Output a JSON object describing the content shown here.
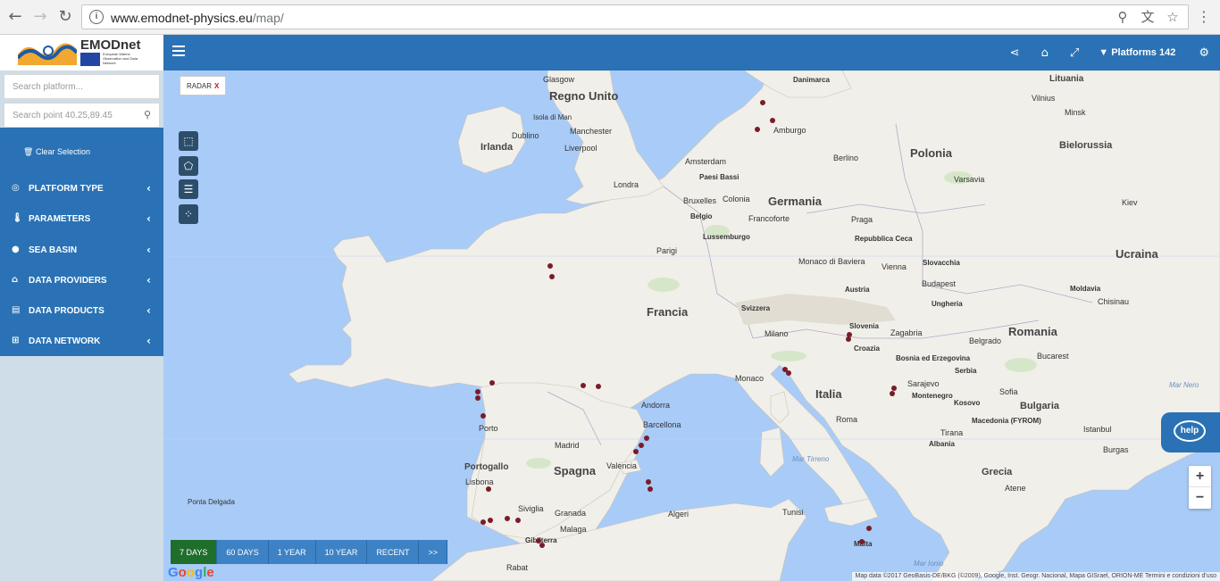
{
  "browser": {
    "url_host": "www.emodnet-physics.eu",
    "url_path": "/map/"
  },
  "header": {
    "logo_text": "EMODnet",
    "logo_sub": "European Marine Observation and Data Network",
    "platforms_label": "Platforms 142"
  },
  "sidebar": {
    "search_platform_placeholder": "Search platform...",
    "search_point_placeholder": "Search point 40.25,89.45",
    "clear_selection": "Clear Selection",
    "items": [
      {
        "label": "PLATFORM TYPE",
        "icon": "target-icon"
      },
      {
        "label": "PARAMETERS",
        "icon": "thermometer-icon"
      },
      {
        "label": "SEA BASIN",
        "icon": "globe-icon"
      },
      {
        "label": "DATA PROVIDERS",
        "icon": "institution-icon"
      },
      {
        "label": "DATA PRODUCTS",
        "icon": "server-icon"
      },
      {
        "label": "DATA NETWORK",
        "icon": "sitemap-icon"
      }
    ]
  },
  "map": {
    "filter_chip": "RADAR",
    "filter_chip_close": "X",
    "time_buttons": [
      "7 DAYS",
      "60 DAYS",
      "1 YEAR",
      "10 YEAR",
      "RECENT",
      ">>"
    ],
    "active_time_button": "7 DAYS",
    "attribution": "Map data ©2017 GeoBasis-DE/BKG (©2009), Google, Inst. Geogr. Nacional, Mapa GISrael, ORION-ME   Termini e condizioni d'uso",
    "google": "Google",
    "help": "help",
    "zoom_in": "+",
    "zoom_out": "−",
    "countries": [
      "Regno Unito",
      "Irlanda",
      "Francia",
      "Spagna",
      "Portogallo",
      "Germania",
      "Polonia",
      "Italia",
      "Ucraina",
      "Romania",
      "Bielorussia",
      "Lituania",
      "Danimarca",
      "Belgio",
      "Paesi Bassi",
      "Svizzera",
      "Austria",
      "Slovacchia",
      "Ungheria",
      "Croazia",
      "Slovenia",
      "Serbia",
      "Bulgaria",
      "Grecia",
      "Albania",
      "Moldavia",
      "Repubblica Ceca",
      "Malta",
      "Gibilterra",
      "Lussemburgo",
      "Montenegro",
      "Macedonia (FYROM)",
      "Kosovo",
      "Bosnia ed Erzegovina"
    ],
    "cities": [
      "Glasgow",
      "Isola di Man",
      "Dublino",
      "Manchester",
      "Liverpool",
      "Londra",
      "Amsterdam",
      "Bruxelles",
      "Amburgo",
      "Berlino",
      "Varsavia",
      "Praga",
      "Monaco di Baviera",
      "Vienna",
      "Budapest",
      "Parigi",
      "Milano",
      "Monaco",
      "Roma",
      "Madrid",
      "Lisbona",
      "Porto",
      "Siviglia",
      "Granada",
      "Malaga",
      "Valencia",
      "Barcellona",
      "Andorra",
      "Algeri",
      "Tunisi",
      "Rabat",
      "Belgrado",
      "Sofia",
      "Bucarest",
      "Kiev",
      "Minsk",
      "Vilnius",
      "Zagabria",
      "Sarajevo",
      "Tirana",
      "Atene",
      "Istanbul",
      "Burgas",
      "Chisinau",
      "Ponta Delgada",
      "Colonia",
      "Francoforte",
      "Sofia"
    ],
    "seas": [
      "Mar Tirreno",
      "Mar Nero",
      "Mar Ionio"
    ]
  }
}
